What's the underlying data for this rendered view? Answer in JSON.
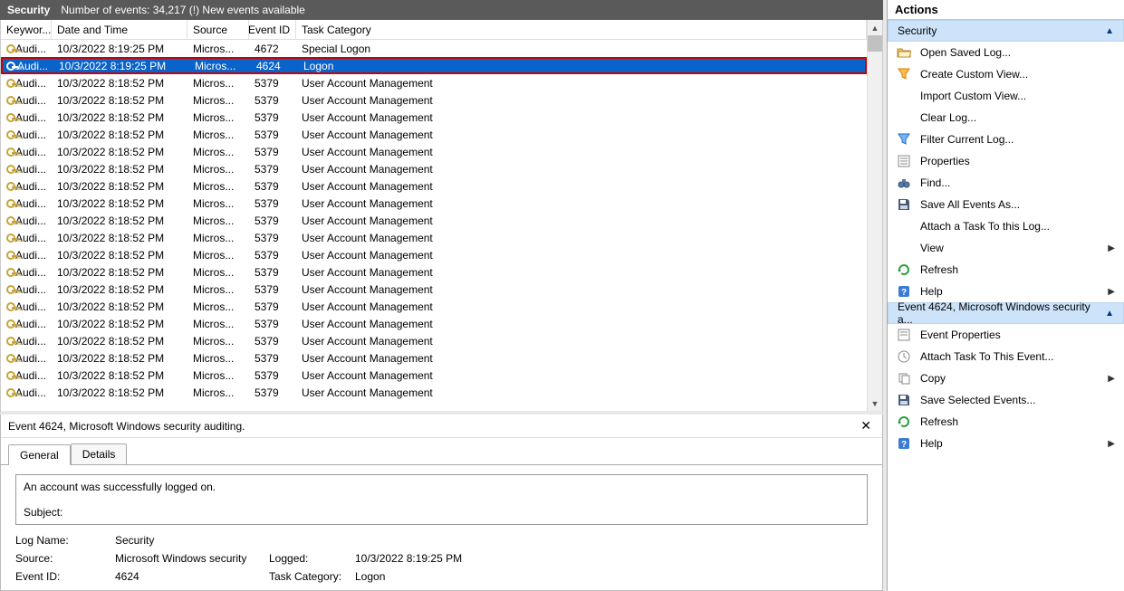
{
  "header": {
    "title": "Security",
    "summary": "Number of events: 34,217 (!) New events available"
  },
  "columns": {
    "kw": "Keywor...",
    "dt": "Date and Time",
    "src": "Source",
    "eid": "Event ID",
    "tc": "Task Category"
  },
  "events": [
    {
      "kw": "Audi...",
      "dt": "10/3/2022 8:19:25 PM",
      "src": "Micros...",
      "eid": "4672",
      "tc": "Special Logon",
      "sel": false
    },
    {
      "kw": "Audi...",
      "dt": "10/3/2022 8:19:25 PM",
      "src": "Micros...",
      "eid": "4624",
      "tc": "Logon",
      "sel": true
    },
    {
      "kw": "Audi...",
      "dt": "10/3/2022 8:18:52 PM",
      "src": "Micros...",
      "eid": "5379",
      "tc": "User Account Management",
      "sel": false
    },
    {
      "kw": "Audi...",
      "dt": "10/3/2022 8:18:52 PM",
      "src": "Micros...",
      "eid": "5379",
      "tc": "User Account Management",
      "sel": false
    },
    {
      "kw": "Audi...",
      "dt": "10/3/2022 8:18:52 PM",
      "src": "Micros...",
      "eid": "5379",
      "tc": "User Account Management",
      "sel": false
    },
    {
      "kw": "Audi...",
      "dt": "10/3/2022 8:18:52 PM",
      "src": "Micros...",
      "eid": "5379",
      "tc": "User Account Management",
      "sel": false
    },
    {
      "kw": "Audi...",
      "dt": "10/3/2022 8:18:52 PM",
      "src": "Micros...",
      "eid": "5379",
      "tc": "User Account Management",
      "sel": false
    },
    {
      "kw": "Audi...",
      "dt": "10/3/2022 8:18:52 PM",
      "src": "Micros...",
      "eid": "5379",
      "tc": "User Account Management",
      "sel": false
    },
    {
      "kw": "Audi...",
      "dt": "10/3/2022 8:18:52 PM",
      "src": "Micros...",
      "eid": "5379",
      "tc": "User Account Management",
      "sel": false
    },
    {
      "kw": "Audi...",
      "dt": "10/3/2022 8:18:52 PM",
      "src": "Micros...",
      "eid": "5379",
      "tc": "User Account Management",
      "sel": false
    },
    {
      "kw": "Audi...",
      "dt": "10/3/2022 8:18:52 PM",
      "src": "Micros...",
      "eid": "5379",
      "tc": "User Account Management",
      "sel": false
    },
    {
      "kw": "Audi...",
      "dt": "10/3/2022 8:18:52 PM",
      "src": "Micros...",
      "eid": "5379",
      "tc": "User Account Management",
      "sel": false
    },
    {
      "kw": "Audi...",
      "dt": "10/3/2022 8:18:52 PM",
      "src": "Micros...",
      "eid": "5379",
      "tc": "User Account Management",
      "sel": false
    },
    {
      "kw": "Audi...",
      "dt": "10/3/2022 8:18:52 PM",
      "src": "Micros...",
      "eid": "5379",
      "tc": "User Account Management",
      "sel": false
    },
    {
      "kw": "Audi...",
      "dt": "10/3/2022 8:18:52 PM",
      "src": "Micros...",
      "eid": "5379",
      "tc": "User Account Management",
      "sel": false
    },
    {
      "kw": "Audi...",
      "dt": "10/3/2022 8:18:52 PM",
      "src": "Micros...",
      "eid": "5379",
      "tc": "User Account Management",
      "sel": false
    },
    {
      "kw": "Audi...",
      "dt": "10/3/2022 8:18:52 PM",
      "src": "Micros...",
      "eid": "5379",
      "tc": "User Account Management",
      "sel": false
    },
    {
      "kw": "Audi...",
      "dt": "10/3/2022 8:18:52 PM",
      "src": "Micros...",
      "eid": "5379",
      "tc": "User Account Management",
      "sel": false
    },
    {
      "kw": "Audi...",
      "dt": "10/3/2022 8:18:52 PM",
      "src": "Micros...",
      "eid": "5379",
      "tc": "User Account Management",
      "sel": false
    },
    {
      "kw": "Audi...",
      "dt": "10/3/2022 8:18:52 PM",
      "src": "Micros...",
      "eid": "5379",
      "tc": "User Account Management",
      "sel": false
    },
    {
      "kw": "Audi...",
      "dt": "10/3/2022 8:18:52 PM",
      "src": "Micros...",
      "eid": "5379",
      "tc": "User Account Management",
      "sel": false
    }
  ],
  "detail": {
    "title": "Event 4624, Microsoft Windows security auditing.",
    "tabs": {
      "general": "General",
      "details": "Details"
    },
    "desc_line1": "An account was successfully logged on.",
    "desc_line2": "Subject:",
    "log_name_lbl": "Log Name:",
    "log_name_val": "Security",
    "source_lbl": "Source:",
    "source_val": "Microsoft Windows security",
    "logged_lbl": "Logged:",
    "logged_val": "10/3/2022 8:19:25 PM",
    "eid_lbl": "Event ID:",
    "eid_val": "4624",
    "tc_lbl": "Task Category:",
    "tc_val": "Logon"
  },
  "side": {
    "title": "Actions",
    "group1": "Security",
    "group2": "Event 4624, Microsoft Windows security a...",
    "a": {
      "open_saved": "Open Saved Log...",
      "create_view": "Create Custom View...",
      "import_view": "Import Custom View...",
      "clear_log": "Clear Log...",
      "filter_log": "Filter Current Log...",
      "properties": "Properties",
      "find": "Find...",
      "save_all": "Save All Events As...",
      "attach_task": "Attach a Task To this Log...",
      "view": "View",
      "refresh": "Refresh",
      "help": "Help",
      "evt_props": "Event Properties",
      "evt_attach": "Attach Task To This Event...",
      "copy": "Copy",
      "save_sel": "Save Selected Events...",
      "refresh2": "Refresh",
      "help2": "Help"
    }
  }
}
